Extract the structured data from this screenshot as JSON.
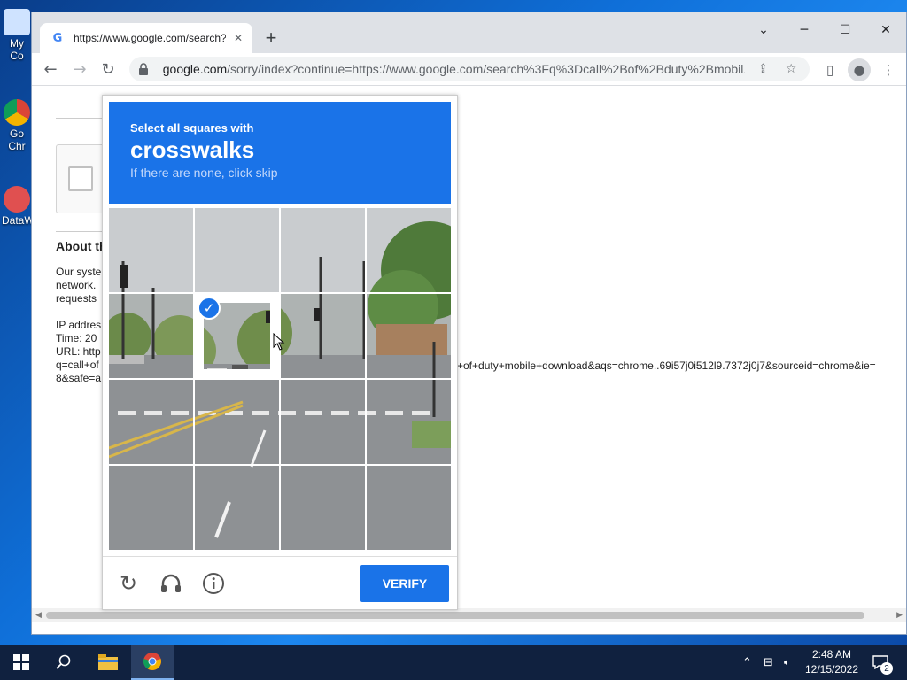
{
  "desktop": {
    "icons": [
      {
        "label": "My Co",
        "name": "my-computer"
      },
      {
        "label": "Go Chr",
        "name": "google-chrome"
      },
      {
        "label": "DataW",
        "name": "dataw"
      }
    ]
  },
  "browser": {
    "tab": {
      "title": "https://www.google.com/search?",
      "favicon": "G"
    },
    "url_host": "google.com",
    "url_rest": "/sorry/index?continue=https://www.google.com/search%3Fq%3Dcall%2Bof%2Bduty%2Bmobil..."
  },
  "page": {
    "about_title": "About th",
    "about_lines": [
      "Our syste",
      "network.",
      "requests",
      "",
      "IP addres",
      "Time: 20",
      "URL: http",
      "q=call+of",
      "8&safe=a"
    ],
    "url_tail": "+of+duty+mobile+download&aqs=chrome..69i57j0i512l9.7372j0j7&sourceid=chrome&ie="
  },
  "captcha": {
    "instruction_small": "Select all squares with",
    "instruction_big": "crosswalks",
    "instruction_sub": "If there are none, click skip",
    "selected_tiles": [
      5
    ],
    "verify_label": "VERIFY",
    "header_color": "#1a73e8"
  },
  "taskbar": {
    "time": "2:48 AM",
    "date": "12/15/2022",
    "notification_count": "2"
  }
}
